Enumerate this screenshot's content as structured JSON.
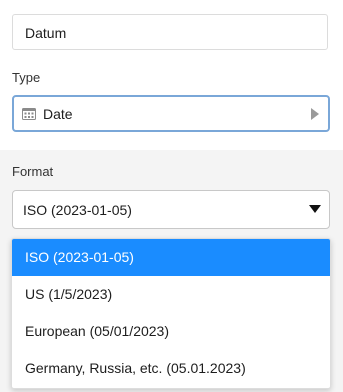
{
  "column_name": {
    "value": "Datum"
  },
  "type_field": {
    "label": "Type",
    "value": "Date",
    "icon": "calendar-icon"
  },
  "format_field": {
    "label": "Format",
    "value": "ISO (2023-01-05)"
  },
  "format_options": [
    {
      "label": "ISO (2023-01-05)",
      "selected": true
    },
    {
      "label": "US (1/5/2023)",
      "selected": false
    },
    {
      "label": "European (05/01/2023)",
      "selected": false
    },
    {
      "label": "Germany, Russia, etc. (05.01.2023)",
      "selected": false
    }
  ],
  "colors": {
    "selected_option_bg": "#1a8cff",
    "focus_border": "#7aa7d8",
    "panel_bg": "#f4f4f4"
  }
}
